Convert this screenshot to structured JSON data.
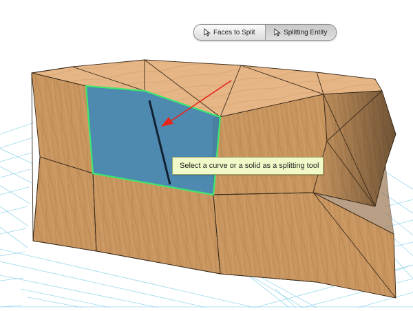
{
  "toolbar": {
    "faces_to_split_label": "Faces to Split",
    "splitting_entity_label": "Splitting Entity",
    "active": "splitting_entity"
  },
  "tooltip": {
    "text": "Select a curve or a solid as a splitting tool"
  },
  "icons": {
    "toolbar_buttons": "cursor-arrow-icon"
  },
  "colors": {
    "selection_outline": "#3ee86e",
    "selected_face": "#3f7fa8",
    "direction_arrow": "#e8261c",
    "grid_lines": "#8fd4ea",
    "wood": "#c9955f"
  }
}
